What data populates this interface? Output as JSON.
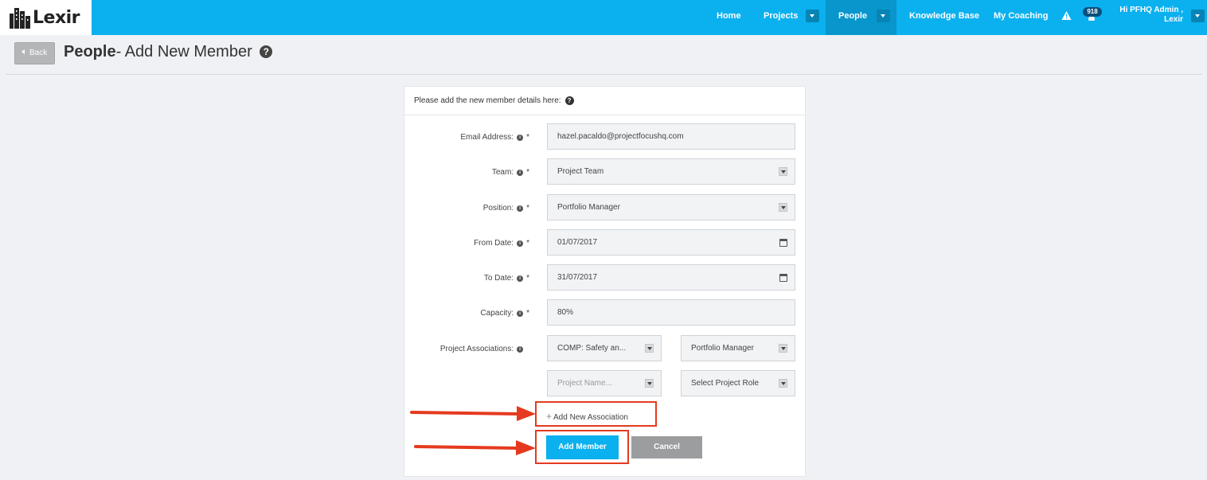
{
  "nav": {
    "brand": "Lexir",
    "items": [
      {
        "label": "Home"
      },
      {
        "label": "Projects"
      },
      {
        "label": "People"
      },
      {
        "label": "Knowledge Base"
      },
      {
        "label": "My Coaching"
      }
    ],
    "notification_count": "918",
    "user_line1": "Hi PFHQ Admin ,",
    "user_line2": "Lexir"
  },
  "header": {
    "back_label": "Back",
    "title_bold": "People",
    "title_rest": "- Add New Member",
    "help_glyph": "?"
  },
  "form": {
    "intro": "Please add the new member details here:",
    "email": {
      "label": "Email Address:",
      "value": "hazel.pacaldo@projectfocushq.com"
    },
    "team": {
      "label": "Team:",
      "value": "Project Team"
    },
    "position": {
      "label": "Position:",
      "value": "Portfolio Manager"
    },
    "from_date": {
      "label": "From Date:",
      "value": "01/07/2017"
    },
    "to_date": {
      "label": "To Date:",
      "value": "31/07/2017"
    },
    "capacity": {
      "label": "Capacity:",
      "value": "80%"
    },
    "associations": {
      "label": "Project Associations:",
      "rows": [
        {
          "project": "COMP: Safety an...",
          "role": "Portfolio Manager"
        },
        {
          "project": "Project Name...",
          "role": "Select Project Role"
        }
      ]
    },
    "required_mark": "*",
    "info_glyph": "i",
    "add_association": "Add New Association",
    "submit": "Add Member",
    "cancel": "Cancel"
  },
  "colors": {
    "nav_bg": "#0bb0ef",
    "nav_active": "#0896cc",
    "primary": "#0bb0ef",
    "highlight": "#e53a1f"
  },
  "icons": [
    "building-logo-icon",
    "caret-down-icon",
    "warning-icon",
    "bell-icon",
    "help-icon",
    "info-icon",
    "calendar-icon",
    "plus-icon",
    "arrow-icon"
  ]
}
